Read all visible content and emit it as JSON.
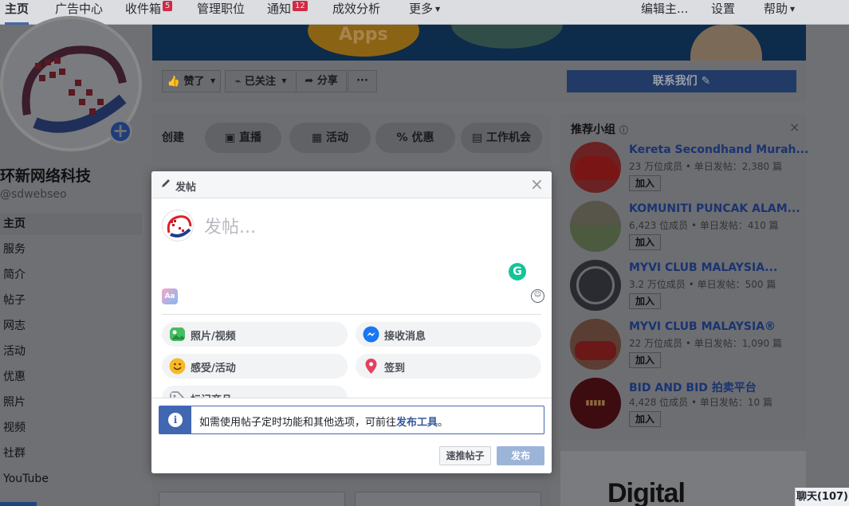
{
  "topnav": {
    "items": [
      {
        "label": "主页"
      },
      {
        "label": "广告中心"
      },
      {
        "label": "收件箱",
        "badge": "5"
      },
      {
        "label": "管理职位"
      },
      {
        "label": "通知",
        "badge": "12"
      },
      {
        "label": "成效分析"
      },
      {
        "label": "更多"
      }
    ],
    "right": [
      {
        "label": "编辑主..."
      },
      {
        "label": "设置"
      },
      {
        "label": "帮助"
      }
    ]
  },
  "page": {
    "name": "环新网络科技",
    "handle": "@sdwebseo"
  },
  "leftnav": {
    "items": [
      "主页",
      "服务",
      "简介",
      "帖子",
      "网志",
      "活动",
      "优惠",
      "照片",
      "视频",
      "社群",
      "YouTube"
    ]
  },
  "cover": {
    "text": "Apps"
  },
  "actions": {
    "like": "赞了",
    "follow": "已关注",
    "share": "分享",
    "more": "···",
    "contact": "联系我们"
  },
  "create": {
    "label": "创建",
    "buttons": [
      "直播",
      "活动",
      "优惠",
      "工作机会"
    ]
  },
  "groups": {
    "title": "推荐小组",
    "close": "×",
    "items": [
      {
        "name": "Kereta Secondhand Murah...",
        "meta": "23 万位成员 • 单日发帖：2,380 篇",
        "join": "加入"
      },
      {
        "name": "KOMUNITI PUNCAK ALAM...",
        "meta": "6,423 位成员 • 单日发帖：410 篇",
        "join": "加入"
      },
      {
        "name": "MYVI CLUB MALAYSIA...",
        "meta": "3.2 万位成员 • 单日发帖：500 篇",
        "join": "加入"
      },
      {
        "name": "MYVI CLUB MALAYSIA®",
        "meta": "22 万位成员 • 单日发帖：1,090 篇",
        "join": "加入"
      },
      {
        "name": "BID AND BID 拍卖平台",
        "meta": "4,428 位成员 • 单日发帖：10 篇",
        "join": "加入"
      }
    ]
  },
  "ad": {
    "text": "Digital"
  },
  "chat": {
    "label": "聊天(107)"
  },
  "composer": {
    "title": "发帖",
    "close": "×",
    "placeholder": "发帖...",
    "aa": "Aa",
    "options": [
      {
        "label": "照片/视频",
        "icon": "photo-icon",
        "color": "#45bd62"
      },
      {
        "label": "接收消息",
        "icon": "messenger-icon",
        "color": "#1877f2"
      },
      {
        "label": "感受/活动",
        "icon": "smiley-icon",
        "color": "#f7b928"
      },
      {
        "label": "签到",
        "icon": "location-pin-icon",
        "color": "#e4405f"
      },
      {
        "label": "标记商品",
        "icon": "tag-product-icon",
        "color": "#90949c"
      }
    ],
    "info_text": "如需使用帖子定时功能和其他选项，可前往",
    "info_link": "发布工具",
    "info_end": "。",
    "boost": "速推帖子",
    "publish": "发布"
  }
}
